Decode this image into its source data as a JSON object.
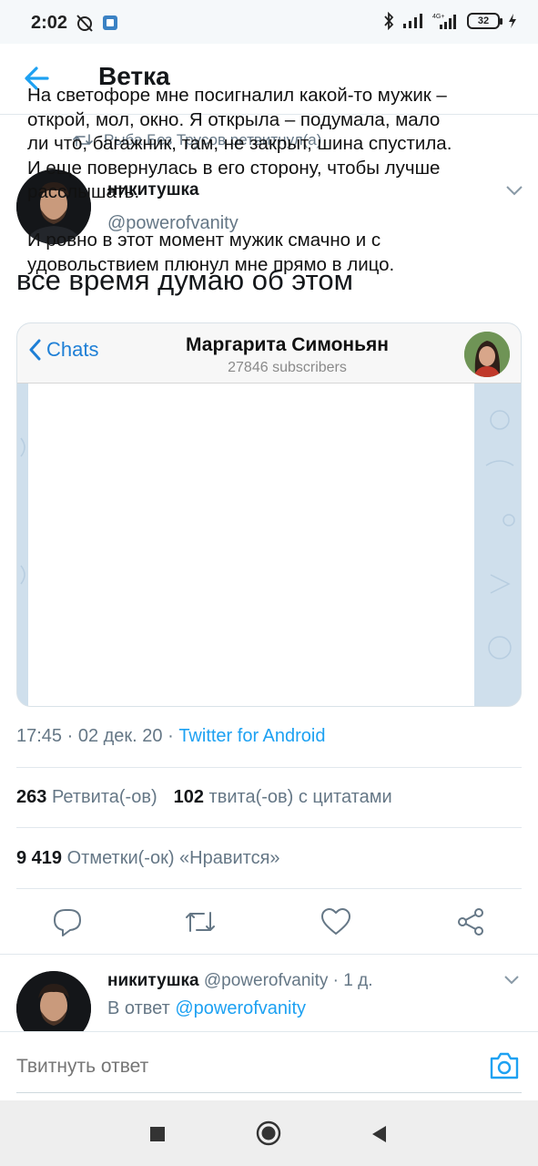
{
  "status_bar": {
    "time": "2:02",
    "battery": "32"
  },
  "header": {
    "title": "Ветка"
  },
  "retweet": {
    "text": "Рыба Без Трусов ретвитнул(а)"
  },
  "tweet": {
    "author_name": "никитушка",
    "author_handle": "@powerofvanity",
    "text": "все время думаю об этом",
    "timestamp": "17:45 · 02 дек. 20 · ",
    "via": "Twitter for Android"
  },
  "embedded": {
    "back_label": "Chats",
    "channel_name": "Маргарита Симоньян",
    "subscribers": "27846 subscribers",
    "message": "На светофоре мне посигналил какой-то мужик – открой, мол, окно. Я открыла – подумала, мало ли что, багажник, там, не закрыт, шина спустила. И еще повернулась в его сторону, чтобы лучше расслышать.\n\nИ ровно в этот момент мужик смачно и с удовольствием плюнул мне прямо в лицо."
  },
  "stats": {
    "retweets_count": "263",
    "retweets_label": "Ретвита(-ов)",
    "quotes_count": "102",
    "quotes_label": "твита(-ов) с цитатами",
    "likes_count": "9 419",
    "likes_label": "Отметки(-ок) «Нравится»"
  },
  "actions": [
    "reply-icon",
    "retweet-icon",
    "heart-icon",
    "share-icon"
  ],
  "reply": {
    "author_name": "никитушка",
    "author_handle_time": "@powerofvanity · 1 д.",
    "in_reply_prefix": "В ответ ",
    "in_reply_handle": "@powerofvanity"
  },
  "compose": {
    "placeholder": "Твитнуть ответ"
  },
  "colors": {
    "accent": "#1da1f2",
    "secondary_text": "#657786",
    "primary_text": "#14171a"
  }
}
